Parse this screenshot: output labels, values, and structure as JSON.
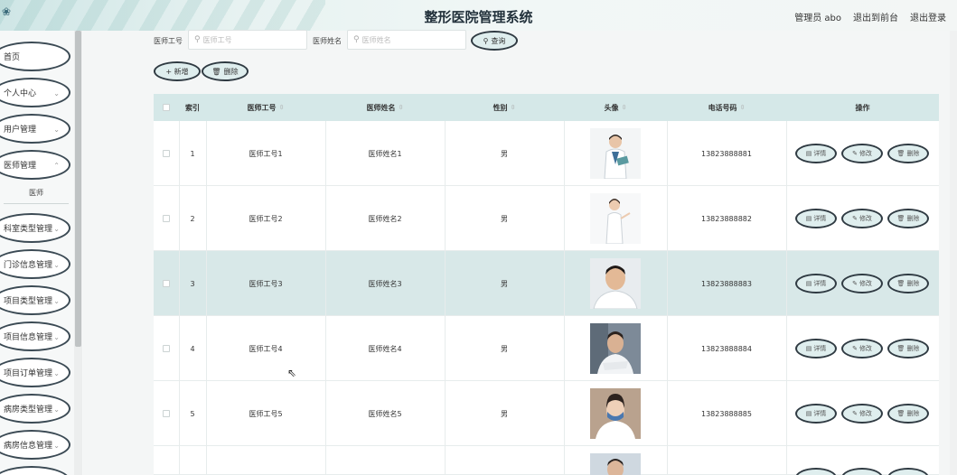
{
  "header": {
    "title": "整形医院管理系统",
    "admin": "管理员 abo",
    "to_front": "退出到前台",
    "logout": "退出登录"
  },
  "sidebar": {
    "items": [
      {
        "label": "首页",
        "chev": ""
      },
      {
        "label": "个人中心",
        "chev": "⌄"
      },
      {
        "label": "用户管理",
        "chev": "⌄"
      },
      {
        "label": "医师管理",
        "chev": "⌃"
      },
      {
        "label": "科室类型管理",
        "chev": "⌄"
      },
      {
        "label": "门诊信息管理",
        "chev": "⌄"
      },
      {
        "label": "项目类型管理",
        "chev": "⌄"
      },
      {
        "label": "项目信息管理",
        "chev": "⌄"
      },
      {
        "label": "项目订单管理",
        "chev": "⌄"
      },
      {
        "label": "病房类型管理",
        "chev": "⌄"
      },
      {
        "label": "病房信息管理",
        "chev": "⌄"
      }
    ],
    "sub_item": "医师"
  },
  "search": {
    "id_label": "医师工号",
    "id_placeholder": "医师工号",
    "name_label": "医师姓名",
    "name_placeholder": "医师姓名",
    "query_button": "查询"
  },
  "toolbar": {
    "add_button": "+ 新增",
    "delete_button": "删除"
  },
  "table": {
    "columns": [
      "索引",
      "医师工号",
      "医师姓名",
      "性别",
      "头像",
      "电话号码",
      "操作"
    ],
    "rows": [
      {
        "index": "1",
        "doctor_id": "医师工号1",
        "name": "医师姓名1",
        "gender": "男",
        "phone": "13823888881"
      },
      {
        "index": "2",
        "doctor_id": "医师工号2",
        "name": "医师姓名2",
        "gender": "男",
        "phone": "13823888882"
      },
      {
        "index": "3",
        "doctor_id": "医师工号3",
        "name": "医师姓名3",
        "gender": "男",
        "phone": "13823888883"
      },
      {
        "index": "4",
        "doctor_id": "医师工号4",
        "name": "医师姓名4",
        "gender": "男",
        "phone": "13823888884"
      },
      {
        "index": "5",
        "doctor_id": "医师工号5",
        "name": "医师姓名5",
        "gender": "男",
        "phone": "13823888885"
      }
    ],
    "actions": {
      "detail": "详情",
      "edit": "修改",
      "delete": "删除"
    }
  },
  "colors": {
    "header_bg": "#e7f2f1",
    "table_header_bg": "#d5e8e8",
    "highlight_row_bg": "#d8e8e8",
    "pill_border": "#2f3a42",
    "pill_bg": "#dfeeee"
  }
}
